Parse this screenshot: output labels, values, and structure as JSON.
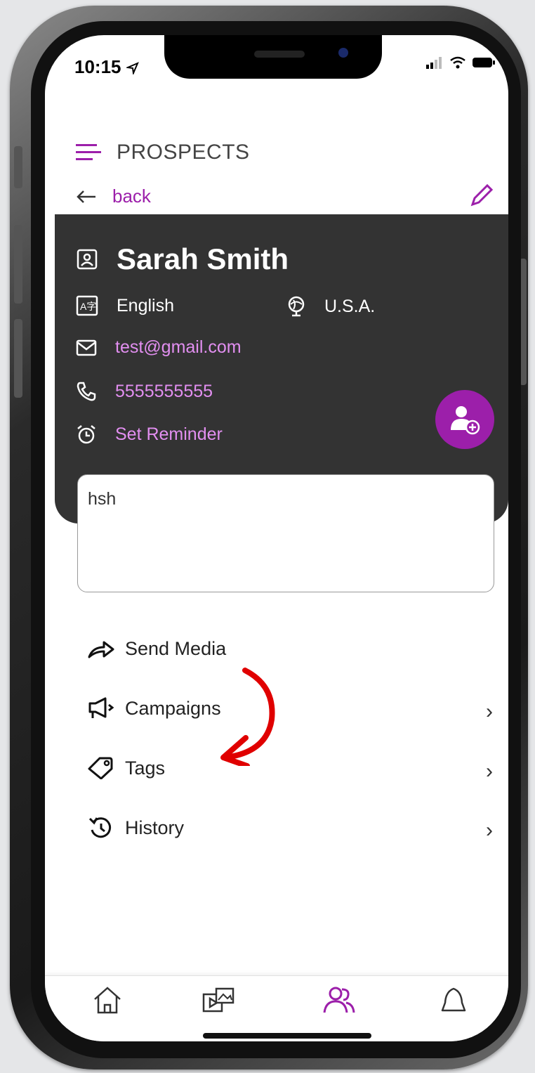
{
  "status_bar": {
    "time": "10:15"
  },
  "header": {
    "title": "PROSPECTS"
  },
  "nav": {
    "back_label": "back"
  },
  "contact": {
    "name": "Sarah Smith",
    "language": "English",
    "country": "U.S.A.",
    "email": "test@gmail.com",
    "phone": "5555555555",
    "reminder_label": "Set Reminder"
  },
  "notes": {
    "value": "hsh"
  },
  "menu": [
    {
      "label": "Send Media",
      "icon": "share-arrow-icon"
    },
    {
      "label": "Campaigns",
      "icon": "megaphone-icon"
    },
    {
      "label": "Tags",
      "icon": "tag-icon"
    },
    {
      "label": "History",
      "icon": "history-icon"
    }
  ],
  "tabs": [
    {
      "name": "home",
      "icon": "home-icon"
    },
    {
      "name": "media",
      "icon": "media-icon"
    },
    {
      "name": "prospects",
      "icon": "people-icon",
      "active": true
    },
    {
      "name": "notifications",
      "icon": "bell-icon"
    }
  ],
  "colors": {
    "accent": "#9c1faa",
    "card": "#333333",
    "link": "#e28ff0",
    "annotation": "#e00000"
  }
}
